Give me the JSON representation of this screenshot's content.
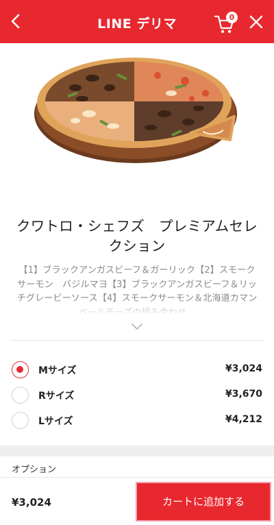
{
  "header": {
    "title": "LINE デリマ",
    "cart_count": "0",
    "color": "#e8282f"
  },
  "icons": {
    "back": "chevron-left-icon",
    "cart": "shopping-cart-icon",
    "close": "close-icon",
    "expand": "chevron-down-icon",
    "product": "pizza-image"
  },
  "product": {
    "title": "クワトロ・シェフズ　プレミアムセレクション",
    "description": "【1】ブラックアンガスビーフ＆ガーリック【2】スモークサーモン　バジルマヨ【3】ブラックアンガスビーフ＆リッチグレービーソース【4】スモークサーモン＆北海道カマンベールチーズの組み合わせ。"
  },
  "sizes": [
    {
      "name": "Mサイズ",
      "price": "¥3,024",
      "selected": true
    },
    {
      "name": "Rサイズ",
      "price": "¥3,670",
      "selected": false
    },
    {
      "name": "Lサイズ",
      "price": "¥4,212",
      "selected": false
    }
  ],
  "options": {
    "label": "オプション"
  },
  "footer": {
    "total": "¥3,024",
    "add_to_cart_label": "カートに追加する"
  }
}
